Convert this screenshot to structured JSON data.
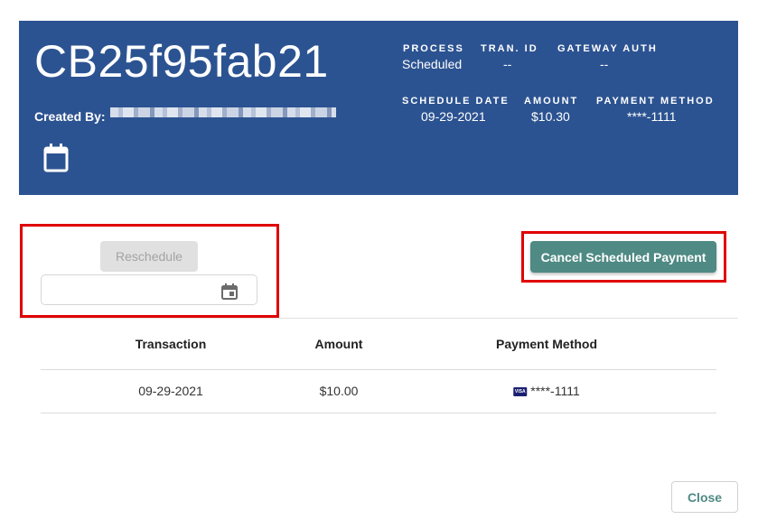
{
  "header": {
    "title": "CB25f95fab21",
    "created_by_label": "Created By:",
    "process_label": "PROCESS",
    "process_value": "Scheduled",
    "tran_id_label": "TRAN. ID",
    "tran_id_value": "--",
    "gateway_auth_label": "GATEWAY AUTH",
    "gateway_auth_value": "--",
    "schedule_date_label": "SCHEDULE DATE",
    "schedule_date_value": "09-29-2021",
    "amount_label": "AMOUNT",
    "amount_value": "$10.30",
    "payment_method_label": "PAYMENT METHOD",
    "payment_method_value": "****-1111",
    "calendar_icon": "calendar-icon"
  },
  "actions": {
    "reschedule_label": "Reschedule",
    "date_input_value": "",
    "cancel_label": "Cancel Scheduled Payment",
    "close_label": "Close"
  },
  "table": {
    "columns": [
      "Transaction",
      "Amount",
      "Payment Method"
    ],
    "rows": [
      {
        "transaction": "09-29-2021",
        "amount": "$10.00",
        "card_brand": "VISA",
        "payment_method": "****-1111"
      }
    ]
  },
  "colors": {
    "header_bg": "#2c5391",
    "accent": "#4f8a84",
    "highlight": "#e00000"
  }
}
